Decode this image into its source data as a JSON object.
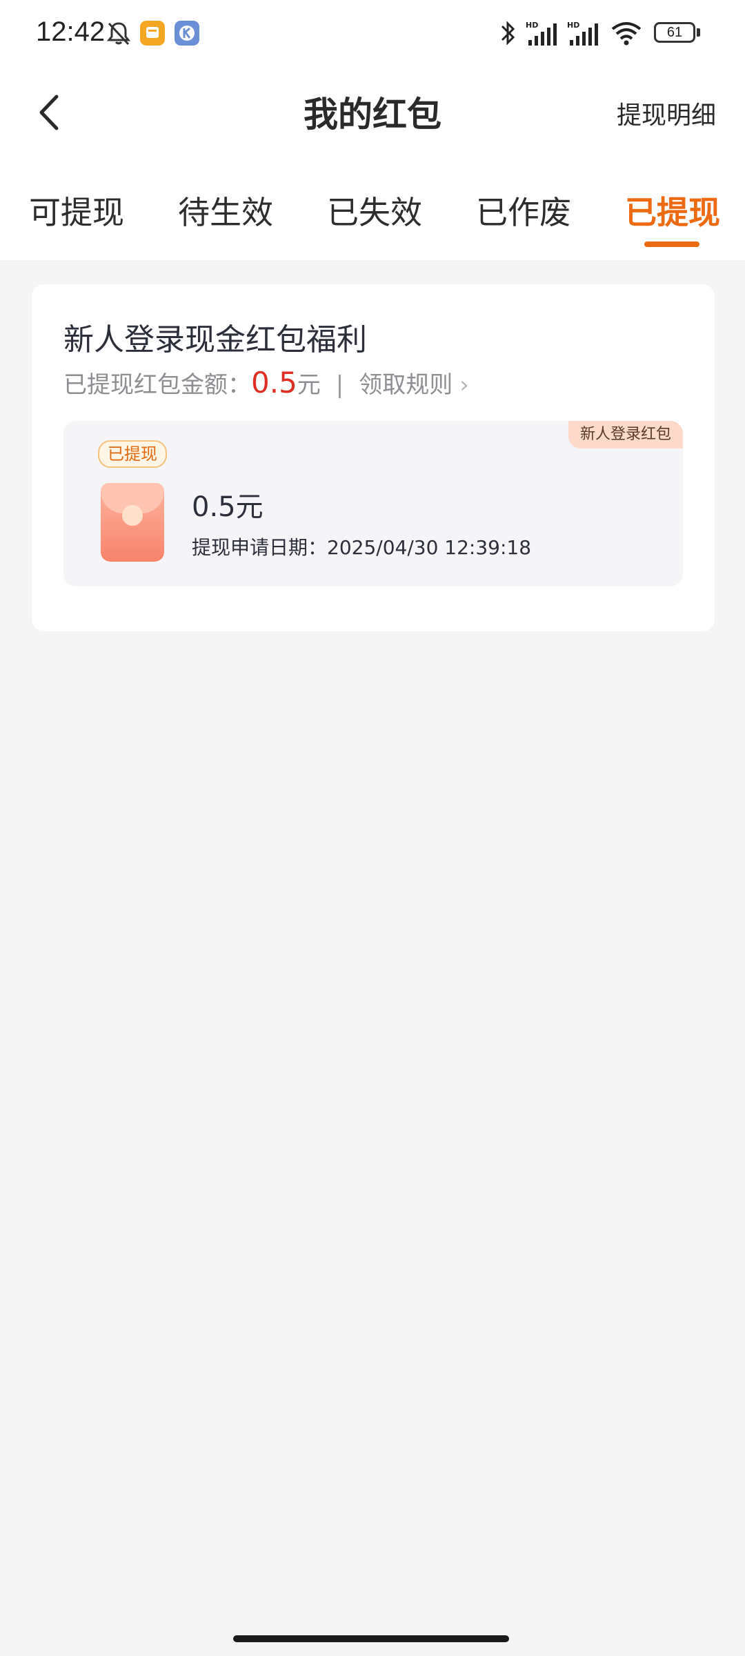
{
  "status_bar": {
    "time": "12:42",
    "battery": "61",
    "icons": [
      "mute-bell-icon",
      "message-app-icon",
      "k-app-icon",
      "bluetooth-icon",
      "signal-hd-icon",
      "signal-hd-icon",
      "wifi-icon",
      "battery-icon"
    ]
  },
  "nav": {
    "title": "我的红包",
    "right_link": "提现明细",
    "back_icon": "back-arrow-icon"
  },
  "tabs": [
    {
      "label": "可提现",
      "active": false
    },
    {
      "label": "待生效",
      "active": false
    },
    {
      "label": "已失效",
      "active": false
    },
    {
      "label": "已作废",
      "active": false
    },
    {
      "label": "已提现",
      "active": true
    }
  ],
  "card": {
    "title": "新人登录现金红包福利",
    "summary_label": "已提现红包金额：",
    "summary_amount": "0.5",
    "summary_unit": "元",
    "separator": "|",
    "rules_link": "领取规则",
    "item": {
      "corner_badge": "新人登录红包",
      "status": "已提现",
      "amount": "0.5元",
      "date": "提现申请日期：2025/04/30 12:39:18"
    }
  },
  "colors": {
    "accent": "#ee6a12",
    "amount_red": "#e02e24",
    "background": "#f5f5f5"
  }
}
